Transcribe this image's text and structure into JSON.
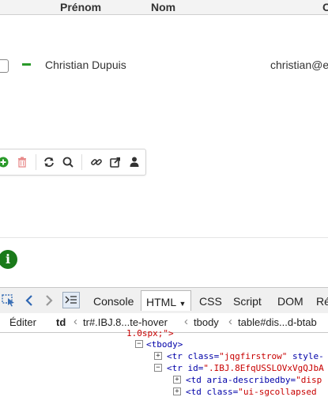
{
  "grid": {
    "headers": {
      "prenom": "Prénom",
      "nom": "Nom",
      "partial": "C"
    },
    "row": {
      "name": "Christian Dupuis",
      "email": "christian@e"
    }
  },
  "toolbar": {
    "icons": [
      "add-icon",
      "delete-icon",
      "refresh-icon",
      "search-icon",
      "link-icon",
      "export-icon",
      "user-icon"
    ],
    "colors": {
      "add": "#2a9a2a",
      "delete": "#e88a8a",
      "default": "#333333"
    }
  },
  "info": {
    "glyph": "i",
    "color": "#1a7a1a"
  },
  "devtools": {
    "tabs": [
      "Console",
      "HTML",
      "CSS",
      "Script",
      "DOM",
      "Ré"
    ],
    "active_tab": "HTML",
    "breadcrumb": {
      "edit": "Éditer",
      "items": [
        "td",
        "tr#.IBJ.8...te-hover",
        "tbody",
        "table#dis...d-btab"
      ]
    },
    "code": {
      "line0": "1.0spx;\">",
      "tbody_tag": "<tbody>",
      "tr1_prefix": "<tr ",
      "tr1_attr": "class=",
      "tr1_val": "\"jqgfirstrow\"",
      "tr1_more": " style-",
      "tr2_prefix": "<tr ",
      "tr2_attr": "id=",
      "tr2_val": "\".IBJ.8EfqUSSLOVxVgQJbA",
      "td1_prefix": "<td ",
      "td1_attr": "aria-describedby=",
      "td1_val": "\"disp",
      "td2_prefix": "<td ",
      "td2_attr": "class=",
      "td2_val": "\"ui-sgcollapsed"
    }
  }
}
